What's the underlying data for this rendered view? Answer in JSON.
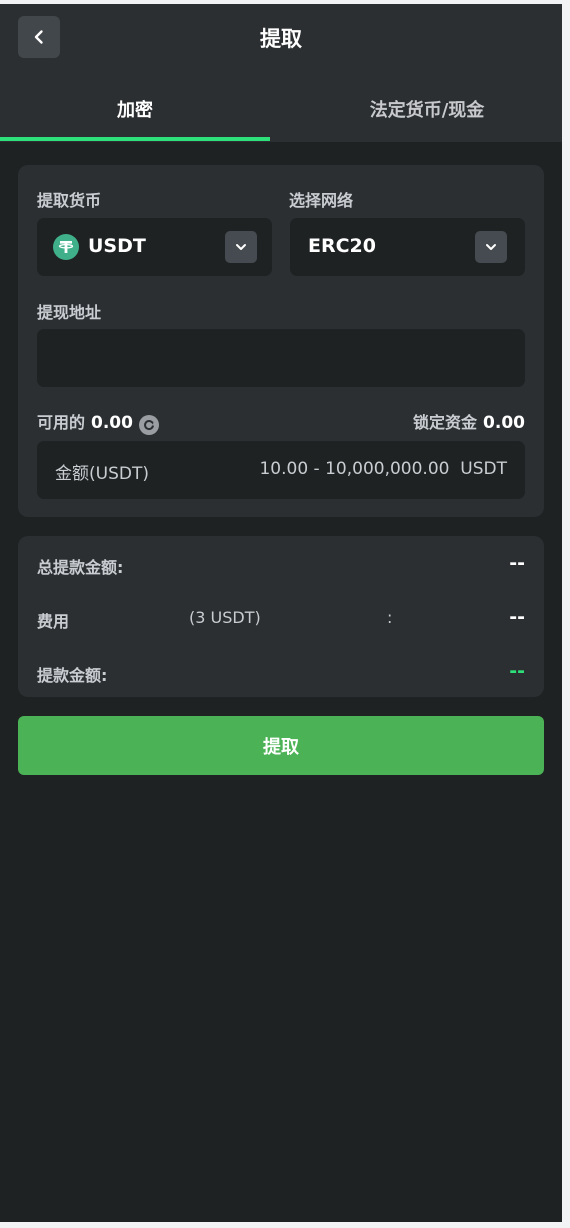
{
  "header": {
    "title": "提取",
    "back_icon": "chevron-left-icon"
  },
  "tabs": [
    {
      "label": "加密",
      "active": true
    },
    {
      "label": "法定货币/现金",
      "active": false
    }
  ],
  "form": {
    "currency_label": "提取货币",
    "currency_value": "USDT",
    "network_label": "选择网络",
    "network_value": "ERC20",
    "address_label": "提现地址",
    "address_value": "",
    "available_label": "可用的",
    "available_value": "0.00",
    "locked_label": "锁定资金",
    "locked_value": "0.00",
    "amount_placeholder": "金额(USDT)",
    "amount_range": "10.00 - 10,000,000.00",
    "amount_unit": "USDT"
  },
  "summary": {
    "total_label": "总提款金额:",
    "total_value": "--",
    "fee_label": "费用",
    "fee_amount": "(3 USDT)",
    "fee_colon": ":",
    "fee_value": "--",
    "receive_label": "提款金额:",
    "receive_value": "--"
  },
  "submit_label": "提取",
  "colors": {
    "accent_green": "#2ee07a",
    "button_green": "#4bb356",
    "background": "#1f2223",
    "card": "#2b2f32"
  }
}
